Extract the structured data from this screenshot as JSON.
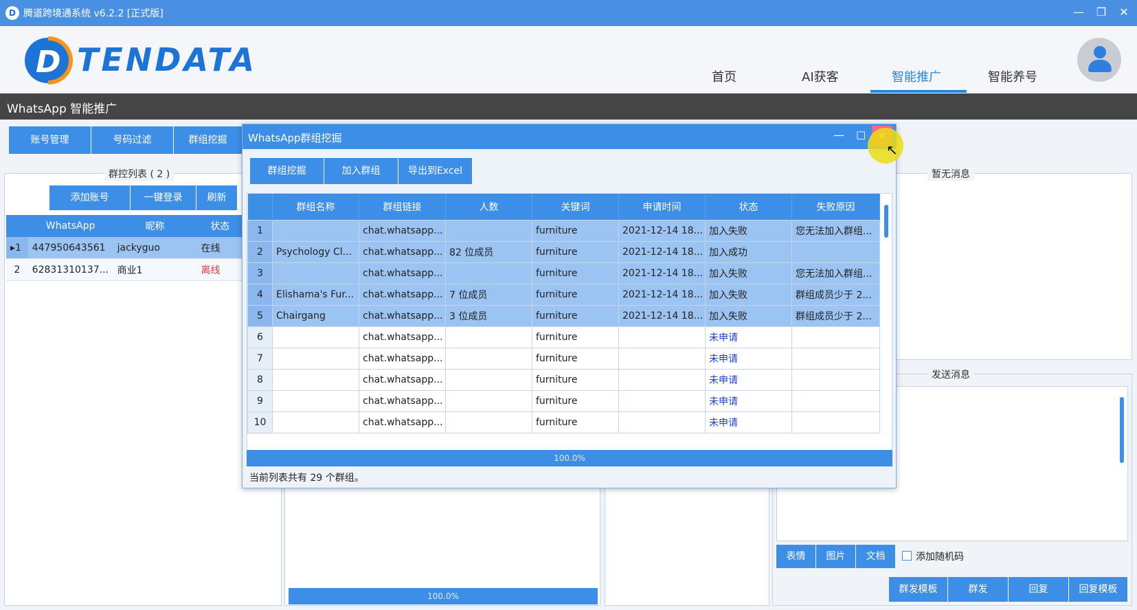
{
  "window": {
    "title": "腾道跨境通系统 v6.2.2 [正式版]"
  },
  "brand": {
    "logo_text": "TENDATA"
  },
  "nav": {
    "items": [
      {
        "label": "首页"
      },
      {
        "label": "AI获客"
      },
      {
        "label": "智能推广",
        "active": true
      },
      {
        "label": "智能养号"
      }
    ]
  },
  "section_title": "WhatsApp 智能推广",
  "toolbar": {
    "tabs": [
      {
        "label": "账号管理"
      },
      {
        "label": "号码过滤"
      },
      {
        "label": "群组挖掘"
      }
    ]
  },
  "group_control": {
    "legend": "群控列表 ( 2 )",
    "buttons": [
      {
        "label": "添加账号"
      },
      {
        "label": "一键登录"
      },
      {
        "label": "刷新"
      }
    ],
    "columns": [
      "WhatsApp",
      "昵称",
      "状态"
    ],
    "rows": [
      {
        "index": "1",
        "whatsapp": "447950643561",
        "nickname": "jackyguo",
        "status": "在线"
      },
      {
        "index": "2",
        "whatsapp": "62831310137...",
        "nickname": "商业1",
        "status": "离线"
      }
    ]
  },
  "dialog": {
    "title": "WhatsApp群组挖掘",
    "buttons": [
      {
        "label": "群组挖掘"
      },
      {
        "label": "加入群组"
      },
      {
        "label": "导出到Excel"
      }
    ],
    "columns": [
      "群组名称",
      "群组链接",
      "人数",
      "关键词",
      "申请时间",
      "状态",
      "失败原因"
    ],
    "rows": [
      {
        "index": "1",
        "name": "",
        "link": "chat.whatsapp...",
        "members": "",
        "keyword": "furniture",
        "time": "2021-12-14 18...",
        "status": "加入失败",
        "reason": "您无法加入群组..."
      },
      {
        "index": "2",
        "name": "Psychology Cl...",
        "link": "chat.whatsapp...",
        "members": "82 位成员",
        "keyword": "furniture",
        "time": "2021-12-14 18...",
        "status": "加入成功",
        "reason": ""
      },
      {
        "index": "3",
        "name": "",
        "link": "chat.whatsapp...",
        "members": "",
        "keyword": "furniture",
        "time": "2021-12-14 18...",
        "status": "加入失败",
        "reason": "您无法加入群组..."
      },
      {
        "index": "4",
        "name": "Elishama's Fur...",
        "link": "chat.whatsapp...",
        "members": "7 位成员",
        "keyword": "furniture",
        "time": "2021-12-14 18...",
        "status": "加入失败",
        "reason": "群组成员少于 2..."
      },
      {
        "index": "5",
        "name": "Chairgang",
        "link": "chat.whatsapp...",
        "members": "3 位成员",
        "keyword": "furniture",
        "time": "2021-12-14 18...",
        "status": "加入失败",
        "reason": "群组成员少于 2..."
      },
      {
        "index": "6",
        "name": "",
        "link": "chat.whatsapp...",
        "members": "",
        "keyword": "furniture",
        "time": "",
        "status": "未申请",
        "reason": ""
      },
      {
        "index": "7",
        "name": "",
        "link": "chat.whatsapp...",
        "members": "",
        "keyword": "furniture",
        "time": "",
        "status": "未申请",
        "reason": ""
      },
      {
        "index": "8",
        "name": "",
        "link": "chat.whatsapp...",
        "members": "",
        "keyword": "furniture",
        "time": "",
        "status": "未申请",
        "reason": ""
      },
      {
        "index": "9",
        "name": "",
        "link": "chat.whatsapp...",
        "members": "",
        "keyword": "furniture",
        "time": "",
        "status": "未申请",
        "reason": ""
      },
      {
        "index": "10",
        "name": "",
        "link": "chat.whatsapp...",
        "members": "",
        "keyword": "furniture",
        "time": "",
        "status": "未申请",
        "reason": ""
      }
    ],
    "progress_label": "100.0%",
    "progress_value": 1.0,
    "footer": "当前列表共有 29 个群组。"
  },
  "bottom_progress": {
    "label": "100.0%",
    "value": 1.0
  },
  "messages": {
    "legend": "暂无消息"
  },
  "send": {
    "legend": "发送消息",
    "attach_buttons": [
      {
        "label": "表情"
      },
      {
        "label": "图片"
      },
      {
        "label": "文档"
      }
    ],
    "random_code_label": "添加随机码",
    "actions": [
      {
        "label": "群发模板"
      },
      {
        "label": "群发"
      },
      {
        "label": "回复"
      },
      {
        "label": "回复模板"
      }
    ]
  },
  "colors": {
    "accent": "#3d8ee6",
    "selected_row": "#9cc4f2",
    "offline": "#e53935",
    "pending": "#1e3fd0"
  }
}
